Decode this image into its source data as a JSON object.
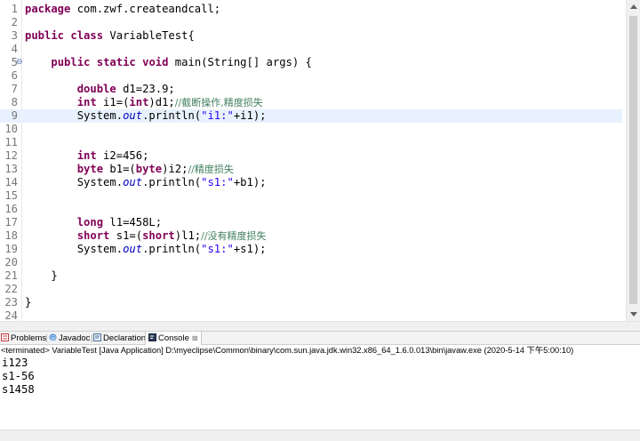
{
  "editor": {
    "lines": [
      {
        "num": "1",
        "tokens": [
          {
            "t": "package",
            "c": "kw"
          },
          {
            "t": " com.zwf.createandcall;",
            "c": ""
          }
        ]
      },
      {
        "num": "2",
        "tokens": []
      },
      {
        "num": "3",
        "tokens": [
          {
            "t": "public",
            "c": "kw"
          },
          {
            "t": " ",
            "c": ""
          },
          {
            "t": "class",
            "c": "kw"
          },
          {
            "t": " VariableTest{",
            "c": ""
          }
        ]
      },
      {
        "num": "4",
        "tokens": []
      },
      {
        "num": "5",
        "fold": "⊖",
        "tokens": [
          {
            "t": "    ",
            "c": ""
          },
          {
            "t": "public",
            "c": "kw"
          },
          {
            "t": " ",
            "c": ""
          },
          {
            "t": "static",
            "c": "kw"
          },
          {
            "t": " ",
            "c": ""
          },
          {
            "t": "void",
            "c": "kw"
          },
          {
            "t": " main(String[] args) {",
            "c": ""
          }
        ]
      },
      {
        "num": "6",
        "tokens": []
      },
      {
        "num": "7",
        "tokens": [
          {
            "t": "        ",
            "c": ""
          },
          {
            "t": "double",
            "c": "kw"
          },
          {
            "t": " d1=23.9;",
            "c": ""
          }
        ]
      },
      {
        "num": "8",
        "tokens": [
          {
            "t": "        ",
            "c": ""
          },
          {
            "t": "int",
            "c": "kw"
          },
          {
            "t": " i1=(",
            "c": ""
          },
          {
            "t": "int",
            "c": "kw"
          },
          {
            "t": ")d1;",
            "c": ""
          },
          {
            "t": "//截断操作,精度损失",
            "c": "cmt"
          }
        ]
      },
      {
        "num": "9",
        "current": true,
        "tokens": [
          {
            "t": "        System.",
            "c": ""
          },
          {
            "t": "out",
            "c": "fld"
          },
          {
            "t": ".println(",
            "c": ""
          },
          {
            "t": "\"i1:\"",
            "c": "str"
          },
          {
            "t": "+i1);",
            "c": ""
          }
        ]
      },
      {
        "num": "10",
        "tokens": []
      },
      {
        "num": "11",
        "tokens": []
      },
      {
        "num": "12",
        "tokens": [
          {
            "t": "        ",
            "c": ""
          },
          {
            "t": "int",
            "c": "kw"
          },
          {
            "t": " i2=456;",
            "c": ""
          }
        ]
      },
      {
        "num": "13",
        "tokens": [
          {
            "t": "        ",
            "c": ""
          },
          {
            "t": "byte",
            "c": "kw"
          },
          {
            "t": " b1=(",
            "c": ""
          },
          {
            "t": "byte",
            "c": "kw"
          },
          {
            "t": ")i2;",
            "c": ""
          },
          {
            "t": "//精度损失",
            "c": "cmt"
          }
        ]
      },
      {
        "num": "14",
        "tokens": [
          {
            "t": "        System.",
            "c": ""
          },
          {
            "t": "out",
            "c": "fld"
          },
          {
            "t": ".println(",
            "c": ""
          },
          {
            "t": "\"s1:\"",
            "c": "str"
          },
          {
            "t": "+b1);",
            "c": ""
          }
        ]
      },
      {
        "num": "15",
        "tokens": []
      },
      {
        "num": "16",
        "tokens": []
      },
      {
        "num": "17",
        "tokens": [
          {
            "t": "        ",
            "c": ""
          },
          {
            "t": "long",
            "c": "kw"
          },
          {
            "t": " l1=458L;",
            "c": ""
          }
        ]
      },
      {
        "num": "18",
        "tokens": [
          {
            "t": "        ",
            "c": ""
          },
          {
            "t": "short",
            "c": "kw"
          },
          {
            "t": " s1=(",
            "c": ""
          },
          {
            "t": "short",
            "c": "kw"
          },
          {
            "t": ")l1;",
            "c": ""
          },
          {
            "t": "//没有精度损失",
            "c": "cmt"
          }
        ]
      },
      {
        "num": "19",
        "tokens": [
          {
            "t": "        System.",
            "c": ""
          },
          {
            "t": "out",
            "c": "fld"
          },
          {
            "t": ".println(",
            "c": ""
          },
          {
            "t": "\"s1:\"",
            "c": "str"
          },
          {
            "t": "+s1);",
            "c": ""
          }
        ]
      },
      {
        "num": "20",
        "tokens": []
      },
      {
        "num": "21",
        "tokens": [
          {
            "t": "    }",
            "c": ""
          }
        ]
      },
      {
        "num": "22",
        "tokens": []
      },
      {
        "num": "23",
        "tokens": [
          {
            "t": "}",
            "c": ""
          }
        ]
      },
      {
        "num": "24",
        "tokens": []
      }
    ]
  },
  "tabs": {
    "problems": "Problems",
    "javadoc": "Javadoc",
    "declaration": "Declaration",
    "console": "Console",
    "close": "⊠",
    "separator": "|"
  },
  "console": {
    "terminated": "<terminated> VariableTest [Java Application] D:\\myeclipse\\Common\\binary\\com.sun.java.jdk.win32.x86_64_1.6.0.013\\bin\\javaw.exe (2020-5-14 下午5:00:10)",
    "output": [
      "i123",
      "s1-56",
      "s1458"
    ]
  },
  "colors": {
    "keyword": "#7f0055",
    "string": "#2a00ff",
    "field": "#0000c0",
    "comment": "#3f7f5f",
    "current_line": "#e8f2fe"
  }
}
